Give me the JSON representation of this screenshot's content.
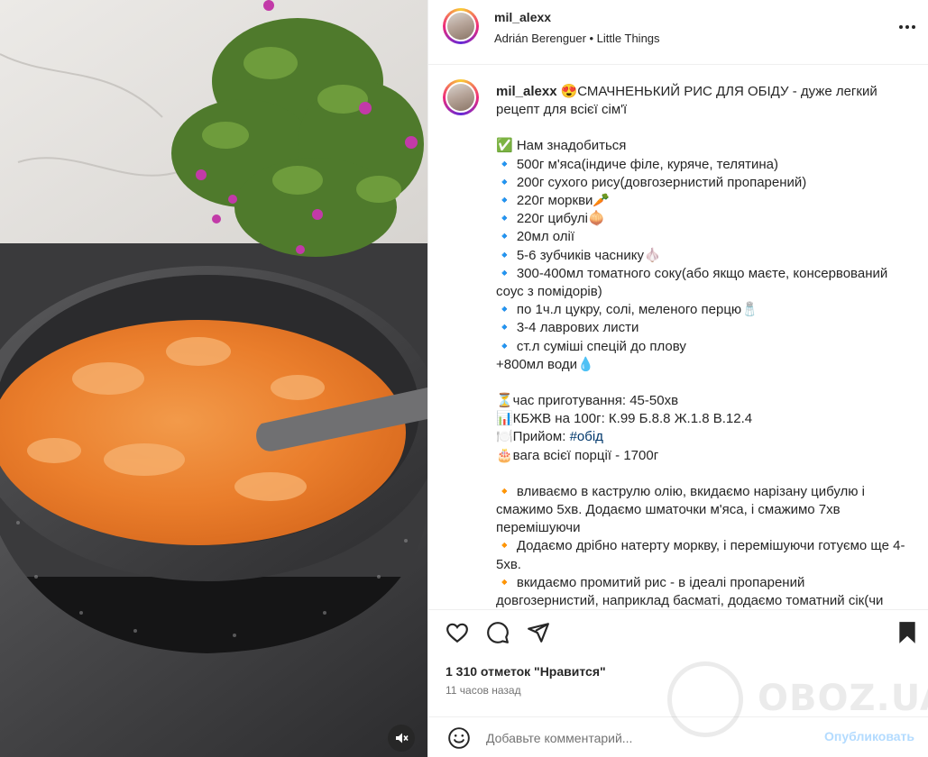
{
  "header": {
    "username": "mil_alexx",
    "subtitle": "Adrián Berenguer • Little Things",
    "more_icon": "more-horizontal-icon"
  },
  "caption": {
    "username": "mil_alexx",
    "lines": [
      "😍СМАЧНЕНЬКИЙ РИС ДЛЯ ОБІДУ - дуже легкий рецепт для всієї сім'ї",
      "",
      "✅ Нам знадобиться",
      "🔹 500г м'яса(індиче філе, куряче, телятина)",
      "🔹 200г сухого рису(довгозернистий пропарений)",
      "🔹 220г моркви🥕",
      "🔹 220г цибулі🧅",
      "🔹 20мл олії",
      "🔹 5-6 зубчиків часнику🧄",
      "🔹 300-400мл томатного соку(або якщо маєте, консервований соус з помідорів)",
      "🔹 по 1ч.л цукру, солі, меленого перцю🧂",
      "🔹 3-4 лаврових листи",
      "🔹 ст.л суміші спецій до плову",
      "+800мл води💧",
      "",
      "⏳час приготування: 45-50хв",
      "📊КБЖВ на 100г: К.99 Б.8.8 Ж.1.8 В.12.4",
      "🍽️Прийом: ",
      "🎂вага всієї порції - 1700г",
      "",
      "🔸 вливаємо в каструлю олію, вкидаємо нарізану цибулю і смажимо 5хв. Додаємо шматочки м'яса, і смажимо 7хв перемішуючи",
      "🔸 Додаємо дрібно натерту моркву, і перемішуючи готуємо ще 4-5хв.",
      "🔸 вкидаємо промитий рис - в ідеалі пропарений довгозернистий, наприклад басматі, додаємо томатний сік(чи"
    ],
    "hashtag": "#обід"
  },
  "actions": {
    "like_icon": "heart-icon",
    "comment_icon": "comment-icon",
    "share_icon": "send-icon",
    "save_icon": "bookmark-icon"
  },
  "likes": "1 310 отметок \"Нравится\"",
  "time": "11 часов назад",
  "comment": {
    "placeholder": "Добавьте комментарий...",
    "post_label": "Опубликовать",
    "emoji_icon": "smiley-icon"
  },
  "watermark": "OBOZ.UA",
  "media": {
    "mute_icon": "speaker-muted-icon"
  },
  "colors": {
    "accent": "#0095f6",
    "post_disabled": "#b3dbff",
    "hashtag": "#00376b",
    "secondary_text": "#737373"
  }
}
